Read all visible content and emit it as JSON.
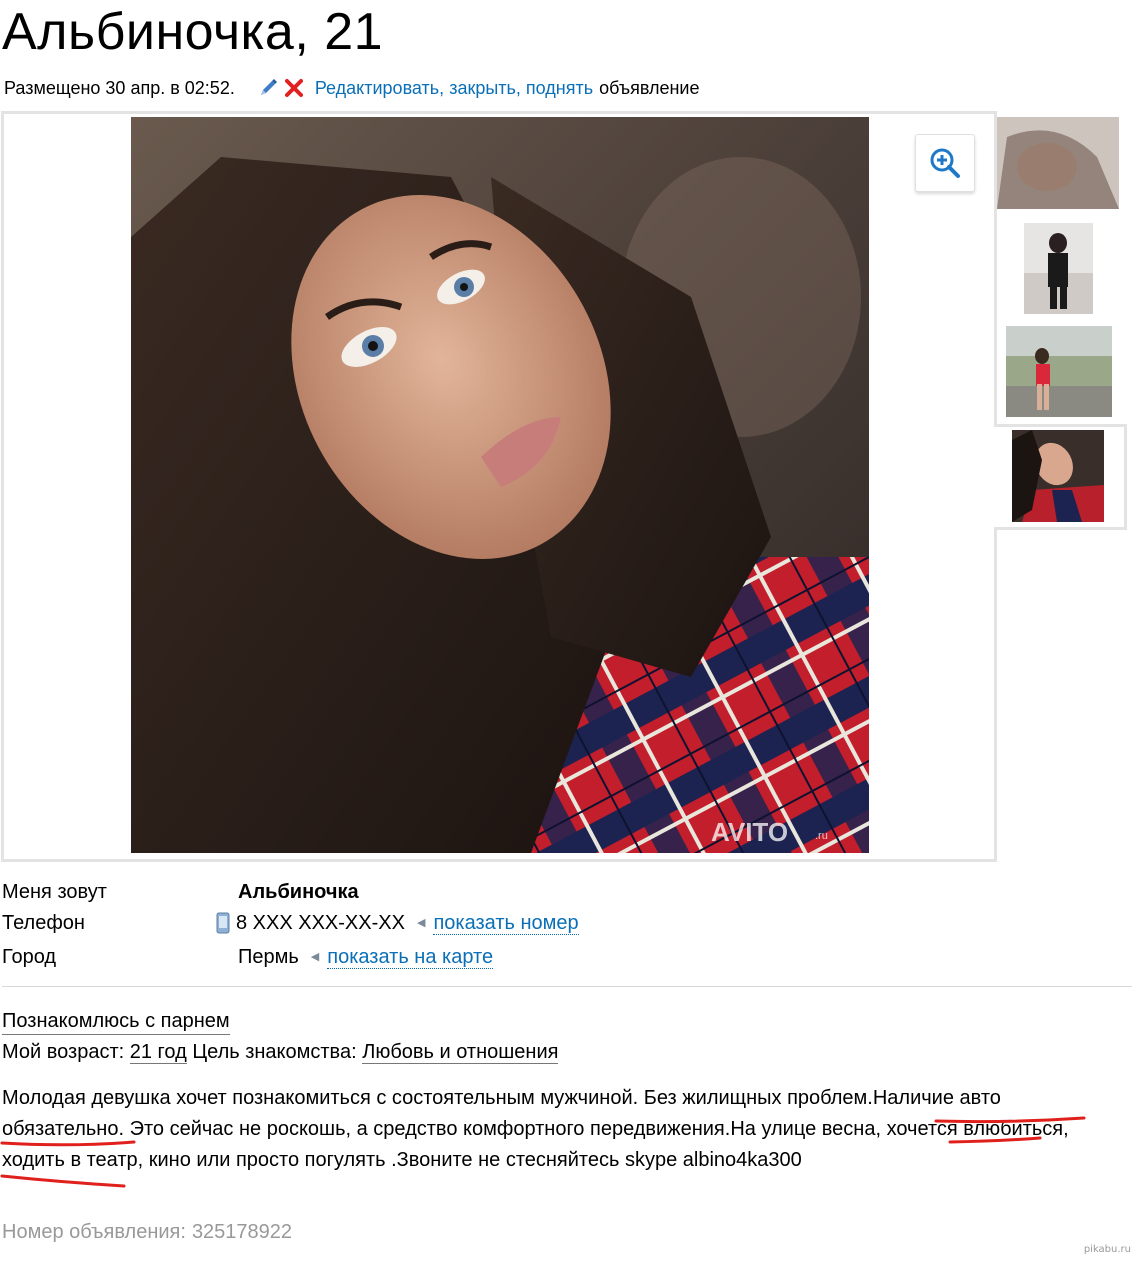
{
  "listing": {
    "title": "Альбиночка, 21",
    "posted": "Размещено 30 апр. в 02:52.",
    "actions": {
      "edit": "Редактировать,",
      "close": "закрыть,",
      "raise": "поднять",
      "tail": "объявление"
    }
  },
  "gallery": {
    "watermark": "AVITO",
    "watermark_suffix": ".ru",
    "thumbnails": 4,
    "selected_index": 4
  },
  "info": {
    "name_label": "Меня зовут",
    "name_value": "Альбиночка",
    "phone_label": "Телефон",
    "phone_value": "8 XXX XXX-XX-XX",
    "phone_link": "показать номер",
    "city_label": "Город",
    "city_value": "Пермь",
    "city_link": "показать на карте"
  },
  "details": {
    "subheading": "Познакомлюсь с парнем",
    "age_label": "Мой возраст:",
    "age_value": "21 год",
    "goal_label": "Цель знакомства:",
    "goal_value": "Любовь и отношения"
  },
  "description": {
    "p1": "Молодая девушка хочет познакомиться с состоятельным мужчиной. Без жилищных проблем.",
    "h1a": "Наличие авто",
    "h1b": "обязательно.",
    "p2": " Это сейчас не роскошь, а средство комфортного передвижения.На улице весна, ",
    "h2a": "хочется",
    "h2b": "влюбиться,",
    "p3": " ходить в театр, кино или просто погулять .Звоните не стесняйтесь skype albino4ka300"
  },
  "ad_number": {
    "label": "Номер объявления:",
    "value": "325178922"
  },
  "site_watermark": "pikabu.ru",
  "colors": {
    "link": "#0a6fb7",
    "underline_marker": "#e0201c",
    "muted": "#999999"
  }
}
